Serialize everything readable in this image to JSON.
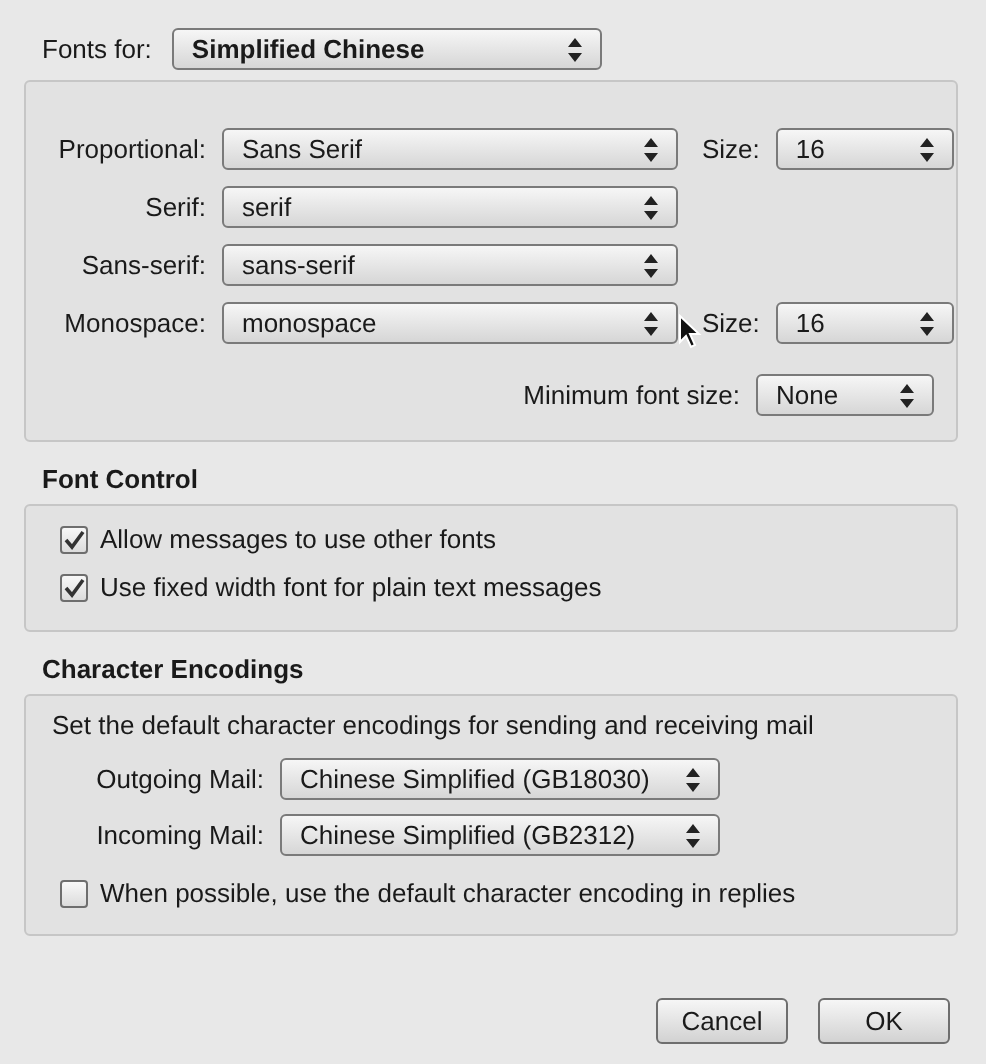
{
  "fonts_for": {
    "label": "Fonts for:",
    "value": "Simplified Chinese"
  },
  "font_rows": [
    {
      "label": "Proportional:",
      "value": "Sans Serif",
      "size_label": "Size:",
      "size": "16"
    },
    {
      "label": "Serif:",
      "value": "serif"
    },
    {
      "label": "Sans-serif:",
      "value": "sans-serif"
    },
    {
      "label": "Monospace:",
      "value": "monospace",
      "size_label": "Size:",
      "size": "16"
    }
  ],
  "minimum_font_size": {
    "label": "Minimum font size:",
    "value": "None"
  },
  "font_control": {
    "title": "Font Control",
    "options": [
      {
        "label": "Allow messages to use other fonts",
        "checked": true
      },
      {
        "label": "Use fixed width font for plain text messages",
        "checked": true
      }
    ]
  },
  "character_encodings": {
    "title": "Character Encodings",
    "description": "Set the default character encodings for sending and receiving mail",
    "fields": [
      {
        "label": "Outgoing Mail:",
        "value": "Chinese Simplified (GB18030)"
      },
      {
        "label": "Incoming Mail:",
        "value": "Chinese Simplified (GB2312)"
      }
    ],
    "option": {
      "label": "When possible, use the default character encoding in replies",
      "checked": false
    }
  },
  "buttons": [
    "Cancel",
    "OK"
  ]
}
